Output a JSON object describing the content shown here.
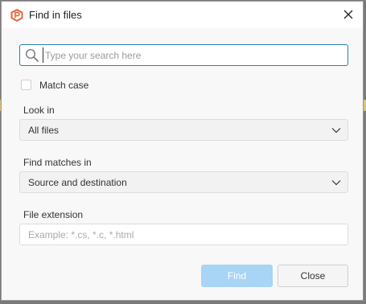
{
  "dialog": {
    "title": "Find in files",
    "colors": {
      "accent": "#2a7fb8",
      "primary_disabled": "#a8d4f6",
      "app_icon": "#e8633a"
    }
  },
  "search": {
    "placeholder": "Type your search here",
    "value": ""
  },
  "match_case": {
    "label": "Match case",
    "checked": false
  },
  "look_in": {
    "label": "Look in",
    "selected": "All files"
  },
  "find_matches_in": {
    "label": "Find matches in",
    "selected": "Source and destination"
  },
  "file_extension": {
    "label": "File extension",
    "placeholder": "Example: *.cs, *.c, *.html",
    "value": ""
  },
  "buttons": {
    "find_label": "Find",
    "close_label": "Close"
  },
  "icons": {
    "app": "diamond-p-logo-icon",
    "close": "close-icon",
    "search": "search-icon",
    "dropdown": "chevron-down-icon"
  }
}
